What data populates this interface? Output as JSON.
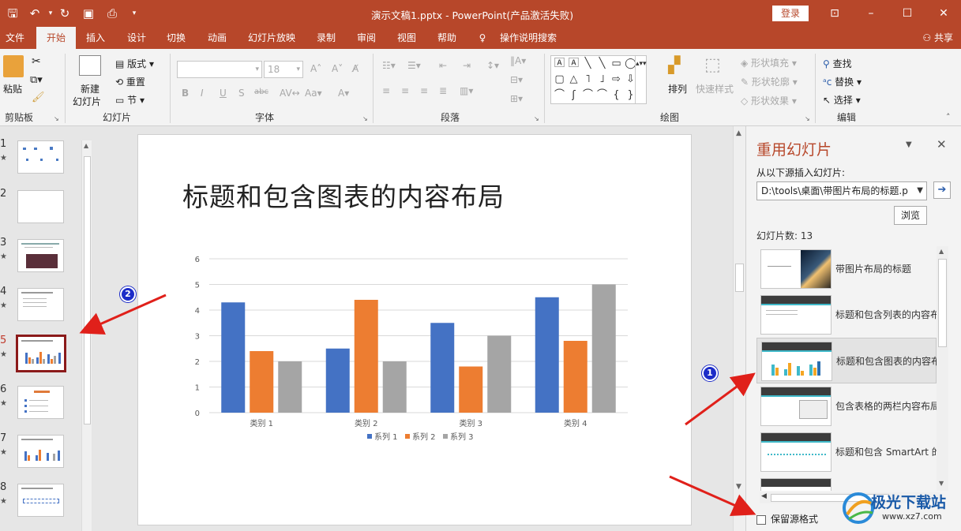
{
  "window": {
    "title": "演示文稿1.pptx  -  PowerPoint(产品激活失败)",
    "login": "登录"
  },
  "tabs": [
    "文件",
    "开始",
    "插入",
    "设计",
    "切换",
    "动画",
    "幻灯片放映",
    "录制",
    "审阅",
    "视图",
    "帮助"
  ],
  "tell_me": "操作说明搜索",
  "share": "共享",
  "ribbon": {
    "clipboard": {
      "label": "剪贴板",
      "paste": "粘贴"
    },
    "slides": {
      "label": "幻灯片",
      "new_slide_1": "新建",
      "new_slide_2": "幻灯片",
      "layout": "版式",
      "reset": "重置",
      "section": "节"
    },
    "font": {
      "label": "字体",
      "size": "18"
    },
    "paragraph": {
      "label": "段落"
    },
    "drawing": {
      "label": "绘图",
      "arrange": "排列",
      "quick_styles": "快速样式",
      "fill": "形状填充",
      "outline": "形状轮廓",
      "effects": "形状效果"
    },
    "editing": {
      "label": "编辑",
      "find": "查找",
      "replace": "替换",
      "select": "选择"
    }
  },
  "thumbnails": [
    {
      "num": "1"
    },
    {
      "num": "2"
    },
    {
      "num": "3"
    },
    {
      "num": "4"
    },
    {
      "num": "5"
    },
    {
      "num": "6"
    },
    {
      "num": "7"
    },
    {
      "num": "8"
    }
  ],
  "slide": {
    "title": "标题和包含图表的内容布局"
  },
  "chart_data": {
    "type": "bar",
    "categories": [
      "类别 1",
      "类别 2",
      "类别 3",
      "类别 4"
    ],
    "series": [
      {
        "name": "系列 1",
        "values": [
          4.3,
          2.5,
          3.5,
          4.5
        ],
        "color": "#4472c4"
      },
      {
        "name": "系列 2",
        "values": [
          2.4,
          4.4,
          1.8,
          2.8
        ],
        "color": "#ed7d31"
      },
      {
        "name": "系列 3",
        "values": [
          2,
          2,
          3,
          5
        ],
        "color": "#a5a5a5"
      }
    ],
    "ylim": [
      0,
      6
    ],
    "yticks": [
      "0",
      "1",
      "2",
      "3",
      "4",
      "5",
      "6"
    ],
    "legend": "bottom",
    "grid": true
  },
  "reuse_pane": {
    "title": "重用幻灯片",
    "insert_from": "从以下源插入幻灯片:",
    "source": "D:\\tools\\桌面\\带图片布局的标题.p",
    "browse": "浏览",
    "slide_count": "幻灯片数: 13",
    "items": [
      "带图片布局的标题",
      "标题和包含列表的内容布局",
      "标题和包含图表的内容布局",
      "包含表格的两栏内容布局",
      "标题和包含 SmartArt 的内容布局"
    ],
    "keep_format": "保留源格式"
  },
  "annotations": {
    "badge1": "1",
    "badge2": "2"
  },
  "watermark": {
    "name": "极光下载站",
    "url": "www.xz7.com"
  }
}
